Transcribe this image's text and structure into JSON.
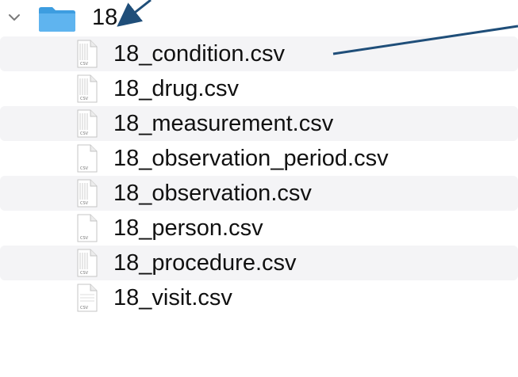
{
  "folder": {
    "name": "18",
    "icon": "folder-icon",
    "expanded": true
  },
  "files": [
    {
      "name": "18_condition.csv",
      "icon": "csv-file-icon"
    },
    {
      "name": "18_drug.csv",
      "icon": "csv-file-icon"
    },
    {
      "name": "18_measurement.csv",
      "icon": "csv-file-icon"
    },
    {
      "name": "18_observation_period.csv",
      "icon": "csv-file-icon"
    },
    {
      "name": "18_observation.csv",
      "icon": "csv-file-icon"
    },
    {
      "name": "18_person.csv",
      "icon": "csv-file-icon"
    },
    {
      "name": "18_procedure.csv",
      "icon": "csv-file-icon"
    },
    {
      "name": "18_visit.csv",
      "icon": "csv-file-icon"
    }
  ],
  "file_icon_label": "CSV",
  "colors": {
    "folder": "#4aa8e8",
    "annotation": "#1f4e79",
    "stripe": "#f4f4f6"
  }
}
